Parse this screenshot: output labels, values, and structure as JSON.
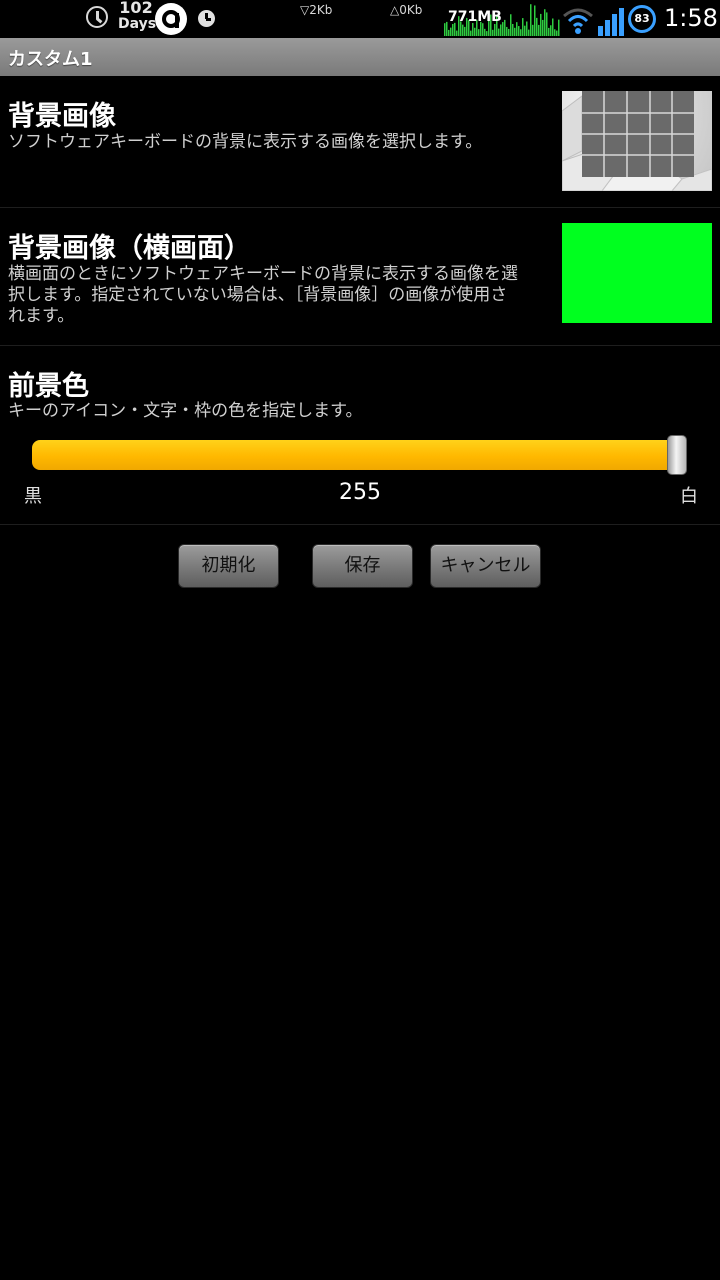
{
  "status_bar": {
    "days_count": "102",
    "days_label": "Days",
    "net_down": "▽2Kb",
    "net_up": "△0Kb",
    "memory": "771MB",
    "battery": "83",
    "time": "1:58",
    "battery_color": "#3aa0ff",
    "graph_color": "#2ecc40"
  },
  "title_bar": {
    "title": "カスタム1"
  },
  "background_image": {
    "title": "背景画像",
    "summary": "ソフトウェアキーボードの背景に表示する画像を選択します。"
  },
  "background_image_landscape": {
    "title": "背景画像（横画面）",
    "summary_line1": "横画面のときにソフトウェアキーボードの背景に表示する画像を選",
    "summary_line2": "択します。指定されていない場合は、［背景画像］の画像が使用さ",
    "summary_line3": "れます。",
    "preview_color": "#00ff1f"
  },
  "foreground_color": {
    "title": "前景色",
    "summary": "キーのアイコン・文字・枠の色を指定します。",
    "slider": {
      "min_label": "黒",
      "max_label": "白",
      "value": "255",
      "fraction": 1.0,
      "track_color": "#ffbf00"
    }
  },
  "buttons": {
    "reset": "初期化",
    "save": "保存",
    "cancel": "キャンセル"
  }
}
